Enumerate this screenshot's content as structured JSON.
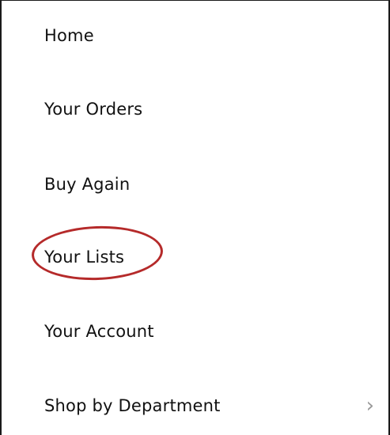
{
  "menu": {
    "items": [
      {
        "label": "Home"
      },
      {
        "label": "Your Orders"
      },
      {
        "label": "Buy Again"
      },
      {
        "label": "Your Lists"
      },
      {
        "label": "Your Account"
      },
      {
        "label": "Shop by Department"
      }
    ],
    "chevron": "›",
    "highlight_color": "#b52a2a"
  }
}
